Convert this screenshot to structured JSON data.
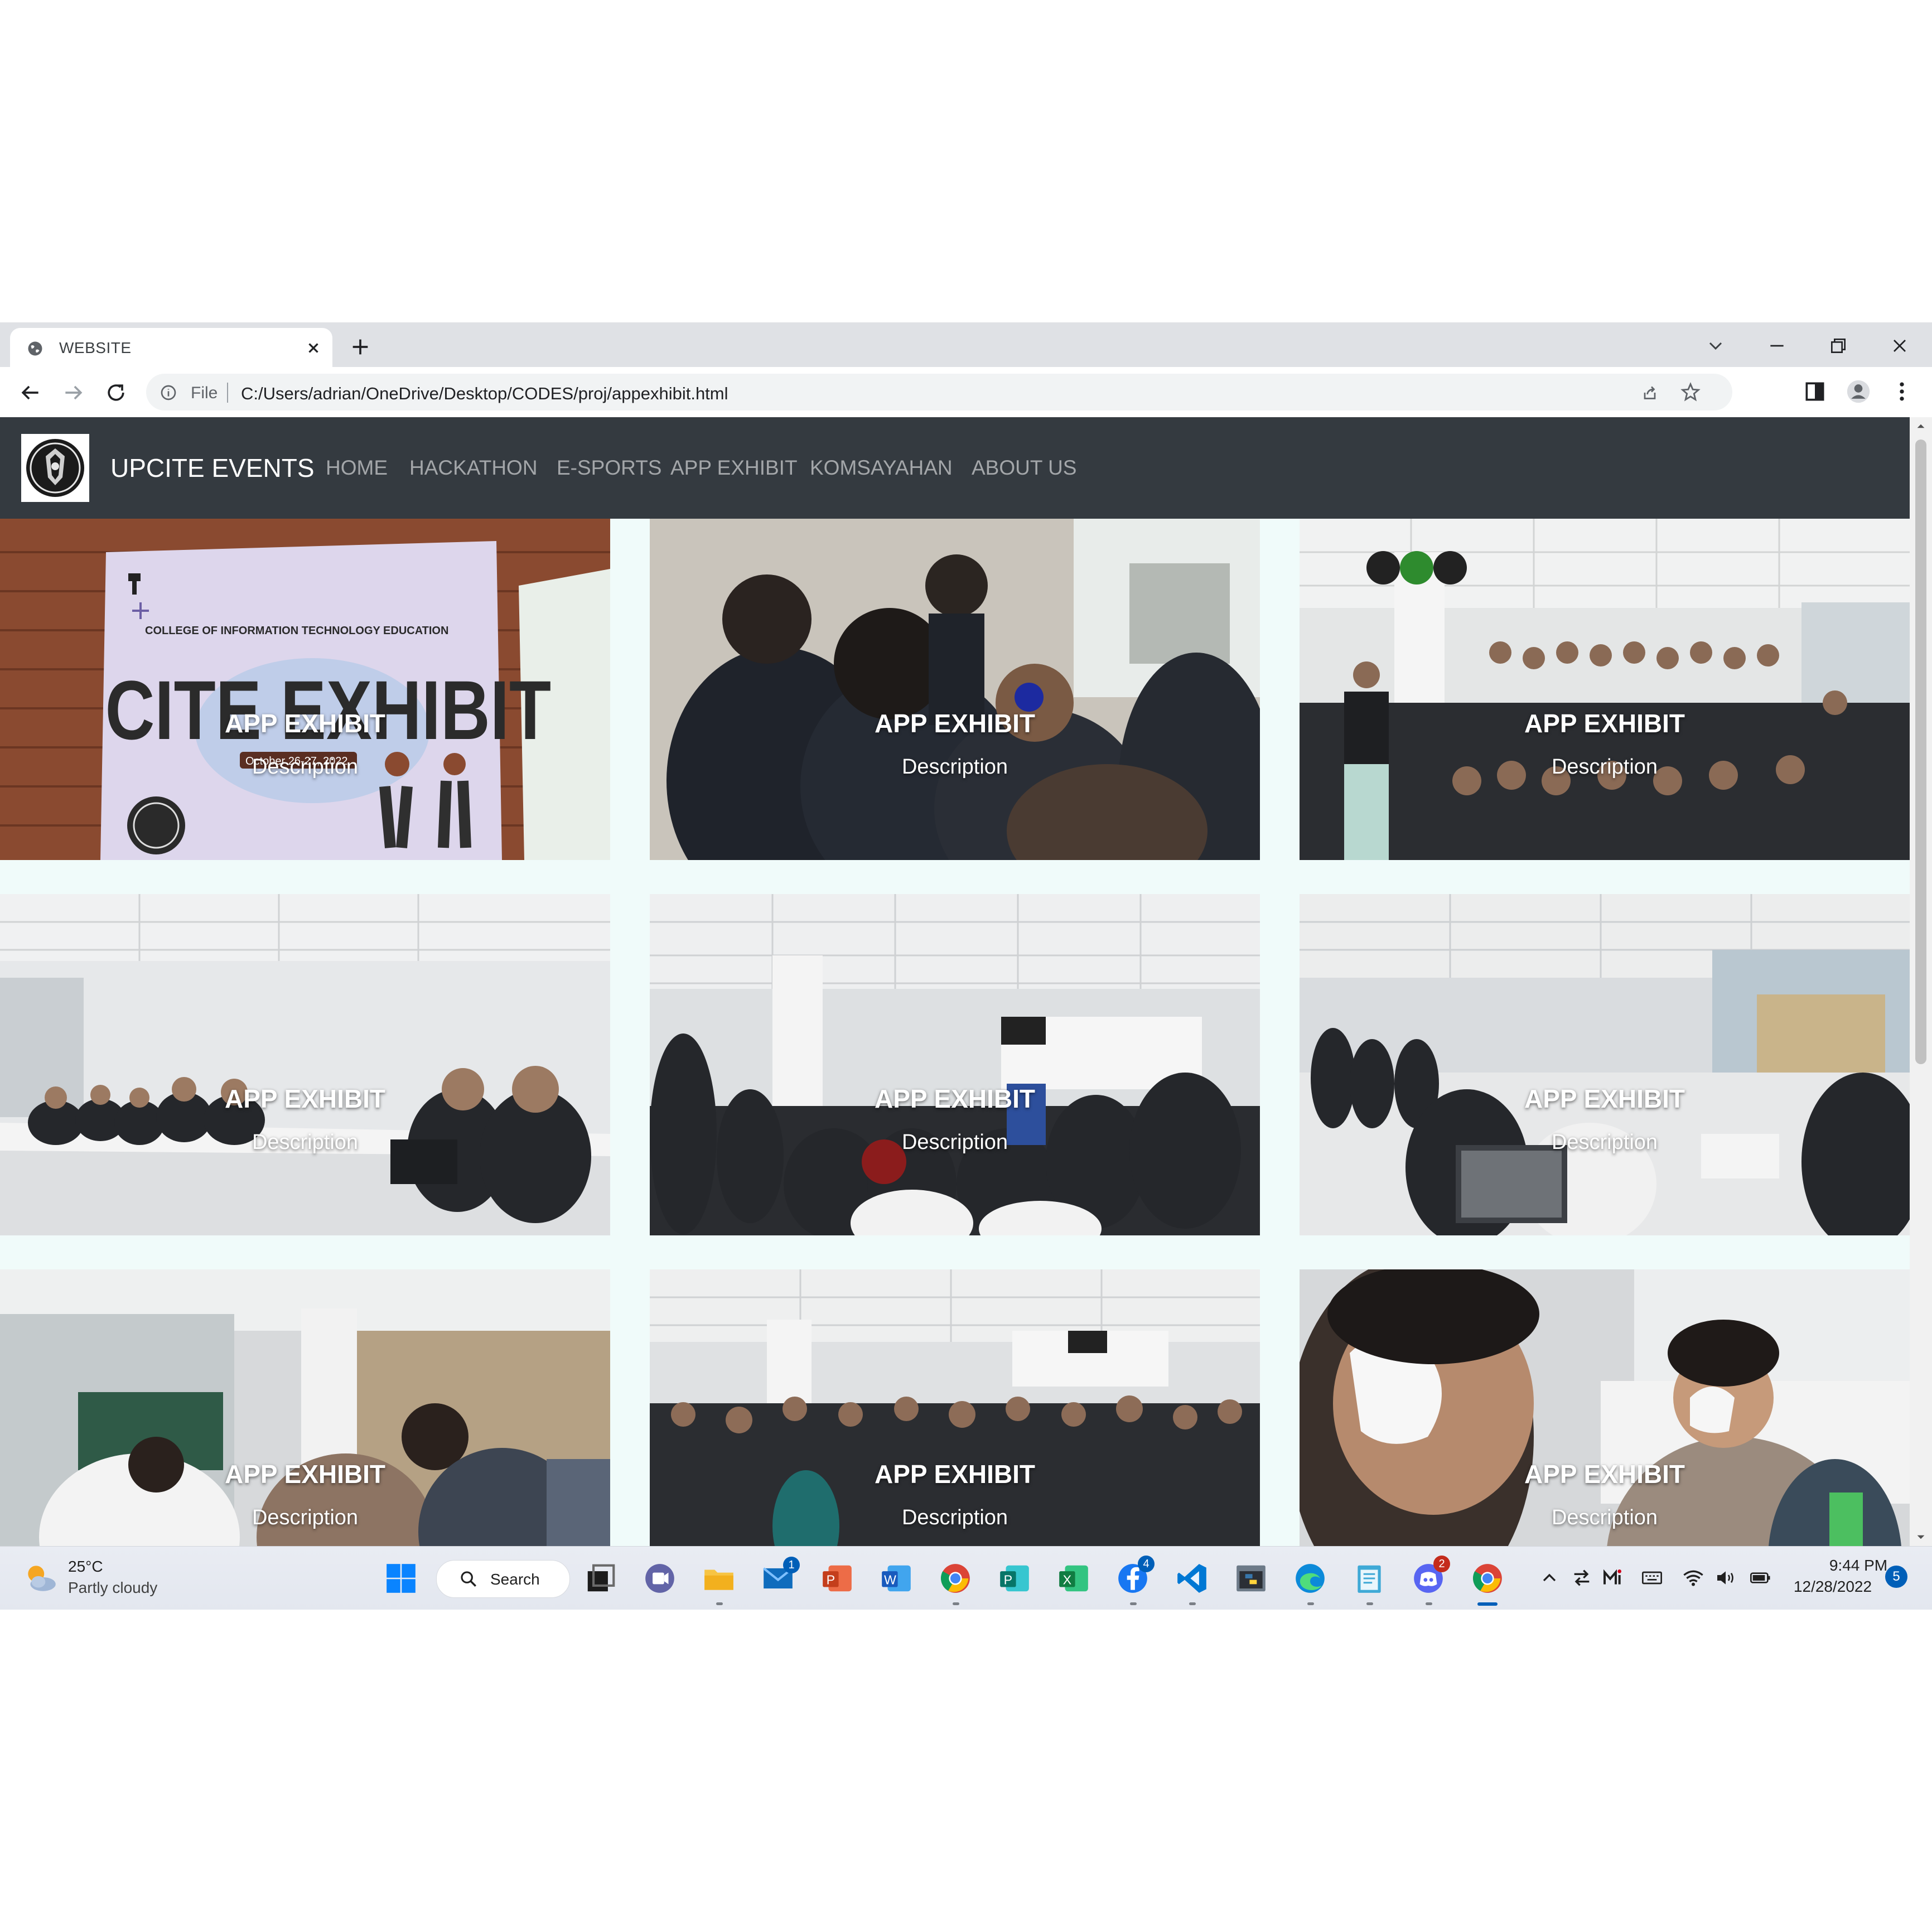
{
  "browser": {
    "tab_title": "WEBSITE",
    "url_scheme": "File",
    "url": "C:/Users/adrian/OneDrive/Desktop/CODES/proj/appexhibit.html"
  },
  "site": {
    "brand": "UPCITE EVENTS",
    "nav": [
      "HOME",
      "HACKATHON",
      "E-SPORTS",
      "APP EXHIBIT",
      "KOMSAYAHAN",
      "ABOUT US"
    ]
  },
  "gallery": [
    {
      "title": "APP EXHIBIT",
      "description": "Description"
    },
    {
      "title": "APP EXHIBIT",
      "description": "Description"
    },
    {
      "title": "APP EXHIBIT",
      "description": "Description"
    },
    {
      "title": "APP EXHIBIT",
      "description": "Description"
    },
    {
      "title": "APP EXHIBIT",
      "description": "Description"
    },
    {
      "title": "APP EXHIBIT",
      "description": "Description"
    },
    {
      "title": "APP EXHIBIT",
      "description": "Description"
    },
    {
      "title": "APP EXHIBIT",
      "description": "Description"
    },
    {
      "title": "APP EXHIBIT",
      "description": "Description"
    }
  ],
  "poster": {
    "college": "COLLEGE OF INFORMATION TECHNOLOGY EDUCATION",
    "headline": "CITE EXHIBIT",
    "date": "October 26-27, 2022"
  },
  "taskbar": {
    "temperature": "25°C",
    "weather": "Partly cloudy",
    "search_label": "Search",
    "mail_badge": "1",
    "facebook_badge": "4",
    "discord_badge": "2",
    "time": "9:44 PM",
    "date": "12/28/2022",
    "notifications": "5"
  },
  "colors": {
    "navbar": "#343a40",
    "page_background": "#f0fbfa",
    "accent": "#005fb8"
  }
}
